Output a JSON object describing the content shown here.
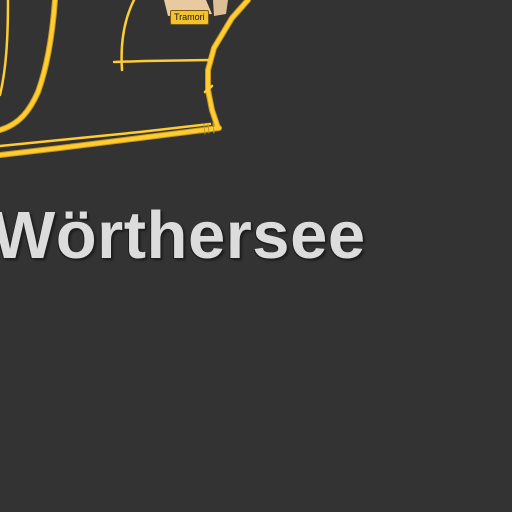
{
  "map": {
    "place_label": "Wörthersee",
    "road_badge": "Tramori"
  },
  "colors": {
    "background": "#333333",
    "road": "#ffcc33",
    "road_casing": "#c89a1c",
    "label_text": "#dcdcdc",
    "badge_fill": "#f2c230",
    "building": "#e8c9a0"
  }
}
